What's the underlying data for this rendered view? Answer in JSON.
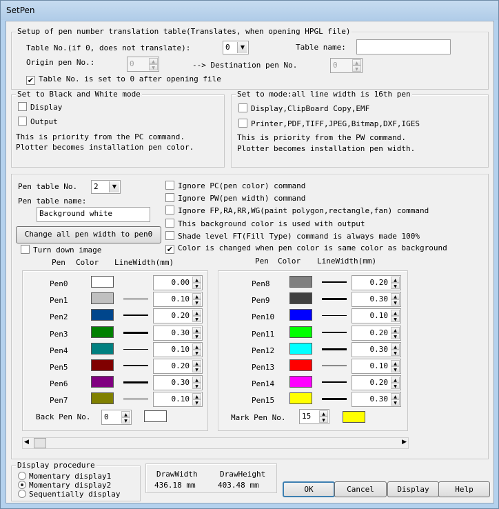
{
  "window": {
    "title": "SetPen"
  },
  "translation": {
    "legend": "Setup of pen number translation table(Translates, when opening HPGL file)",
    "table_no_label": "Table No.(if 0, does not translate):",
    "table_no_value": "0",
    "table_name_label": "Table name:",
    "table_name_value": "",
    "origin_label": "Origin pen No.:",
    "origin_value": "0",
    "arrow_label": "-->  Destination pen No.",
    "destination_value": "0",
    "reset_label": "Table No. is set to 0 after opening file",
    "reset_checked": true
  },
  "bw": {
    "legend": "Set to Black and White mode",
    "display_label": "Display",
    "output_label": "Output",
    "note1": "This is priority from the PC command.",
    "note2": "Plotter becomes installation pen color."
  },
  "width16": {
    "legend": "Set to mode:all line width is 16th pen",
    "display_label": "Display,ClipBoard Copy,EMF",
    "printer_label": "Printer,PDF,TIFF,JPEG,Bitmap,DXF,IGES",
    "note1": "This is priority from the PW command.",
    "note2": "Plotter becomes installation pen width."
  },
  "pentable": {
    "no_label": "Pen table No.",
    "no_value": "2",
    "name_label": "Pen table name:",
    "name_value": "Background white",
    "change_button": "Change all pen width to pen0",
    "turn_down_label": "Turn down image",
    "options": [
      {
        "label": "Ignore PC(pen color) command",
        "checked": false
      },
      {
        "label": "Ignore PW(pen width) command",
        "checked": false
      },
      {
        "label": "Ignore FP,RA,RR,WG(paint polygon,rectangle,fan) command",
        "checked": false
      },
      {
        "label": "This background color is used with output",
        "checked": false
      },
      {
        "label": "Shade level FT(Fill Type) command is always made 100%",
        "checked": false
      },
      {
        "label": "Color is changed when pen color is same color as background",
        "checked": true
      }
    ],
    "header": {
      "pen": "Pen",
      "color": "Color",
      "width": "LineWidth(mm)"
    },
    "pens_left": [
      {
        "name": "Pen0",
        "color": "#ffffff",
        "width": "0.00"
      },
      {
        "name": "Pen1",
        "color": "#c0c0c0",
        "width": "0.10"
      },
      {
        "name": "Pen2",
        "color": "#00468c",
        "width": "0.20"
      },
      {
        "name": "Pen3",
        "color": "#008000",
        "width": "0.30"
      },
      {
        "name": "Pen4",
        "color": "#008080",
        "width": "0.10"
      },
      {
        "name": "Pen5",
        "color": "#800000",
        "width": "0.20"
      },
      {
        "name": "Pen6",
        "color": "#800080",
        "width": "0.30"
      },
      {
        "name": "Pen7",
        "color": "#808000",
        "width": "0.10"
      }
    ],
    "pens_right": [
      {
        "name": "Pen8",
        "color": "#808080",
        "width": "0.20"
      },
      {
        "name": "Pen9",
        "color": "#404040",
        "width": "0.30"
      },
      {
        "name": "Pen10",
        "color": "#0000ff",
        "width": "0.10"
      },
      {
        "name": "Pen11",
        "color": "#00ff00",
        "width": "0.20"
      },
      {
        "name": "Pen12",
        "color": "#00ffff",
        "width": "0.30"
      },
      {
        "name": "Pen13",
        "color": "#ff0000",
        "width": "0.10"
      },
      {
        "name": "Pen14",
        "color": "#ff00ff",
        "width": "0.20"
      },
      {
        "name": "Pen15",
        "color": "#ffff00",
        "width": "0.30"
      }
    ],
    "back_pen_label": "Back Pen No.",
    "back_pen_value": "0",
    "back_pen_color": "#ffffff",
    "mark_pen_label": "Mark Pen No.",
    "mark_pen_value": "15",
    "mark_pen_color": "#ffff00"
  },
  "display": {
    "legend": "Display procedure",
    "options": [
      {
        "label": "Momentary display1",
        "selected": false
      },
      {
        "label": "Momentary display2",
        "selected": true
      },
      {
        "label": "Sequentially display",
        "selected": false
      }
    ],
    "draw_width_label": "DrawWidth",
    "draw_width_value": "436.18 mm",
    "draw_height_label": "DrawHeight",
    "draw_height_value": "403.48 mm"
  },
  "buttons": {
    "ok": "OK",
    "cancel": "Cancel",
    "display": "Display",
    "help": "Help"
  }
}
